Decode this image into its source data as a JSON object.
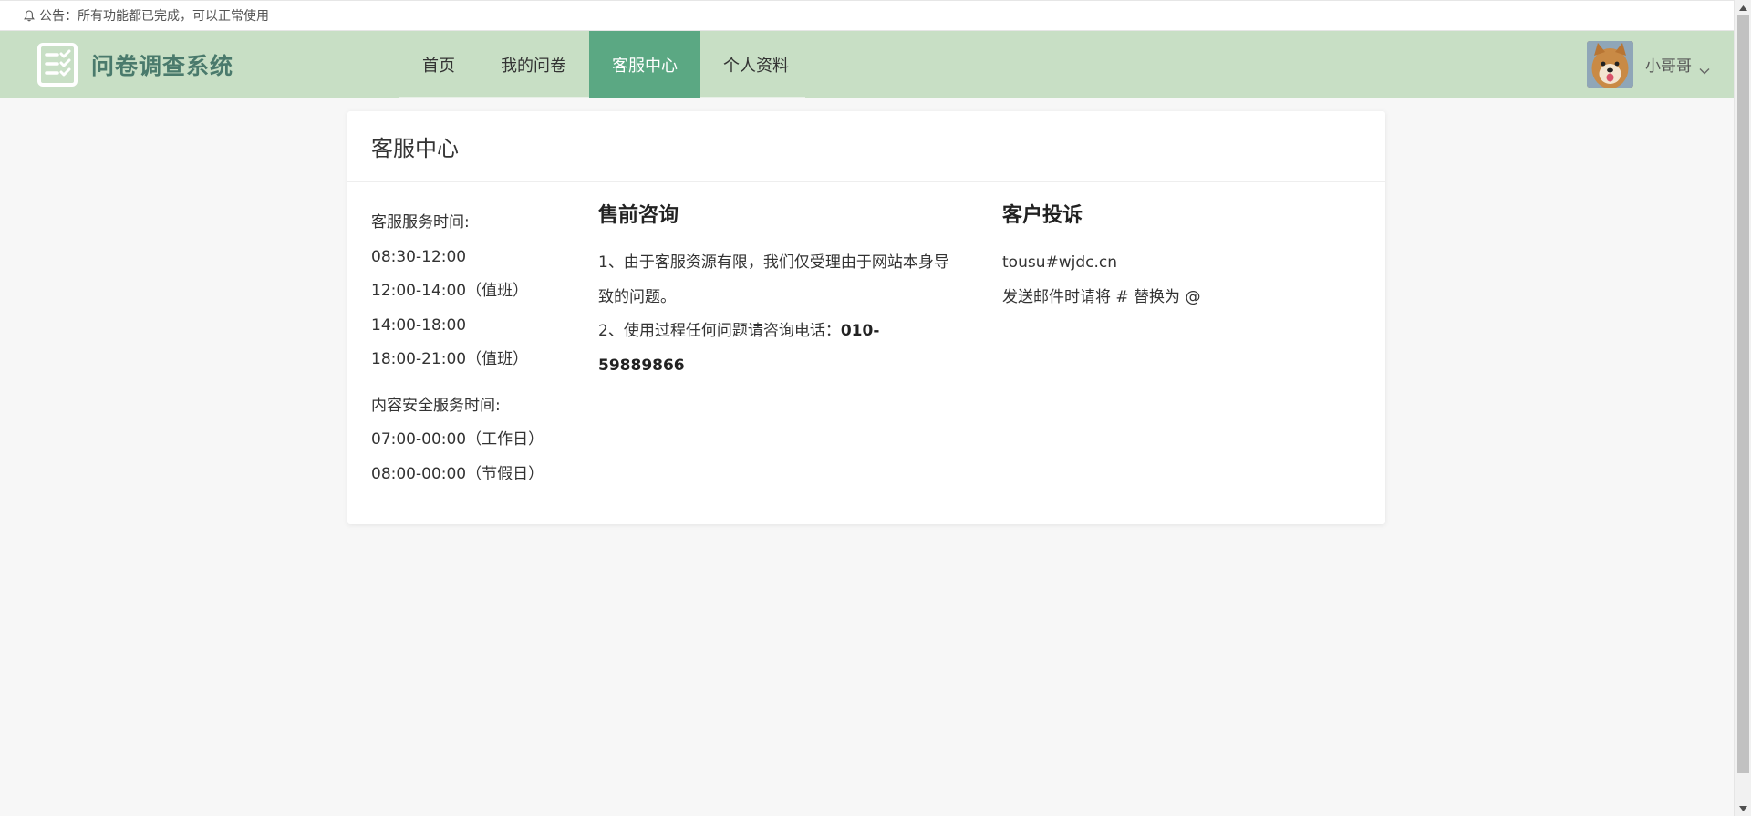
{
  "notice": {
    "label": "公告：所有功能都已完成，可以正常使用"
  },
  "header": {
    "logo_text": "问卷调查系统",
    "nav": [
      {
        "label": "首页",
        "active": false
      },
      {
        "label": "我的问卷",
        "active": false
      },
      {
        "label": "客服中心",
        "active": true
      },
      {
        "label": "个人资料",
        "active": false
      }
    ],
    "user": {
      "name": "小哥哥"
    }
  },
  "card": {
    "title": "客服中心",
    "hours": {
      "service_label": "客服服务时间:",
      "service_times": [
        "08:30-12:00",
        "12:00-14:00（值班）",
        "14:00-18:00",
        "18:00-21:00（值班）"
      ],
      "security_label": "内容安全服务时间:",
      "security_times": [
        "07:00-00:00（工作日）",
        "08:00-00:00（节假日）"
      ]
    },
    "presale": {
      "title": "售前咨询",
      "item1": "1、由于客服资源有限，我们仅受理由于网站本身导致的问题。",
      "item2_prefix": "2、使用过程任何问题请咨询电话：",
      "phone": "010-59889866"
    },
    "complaint": {
      "title": "客户投诉",
      "email": "tousu#wjdc.cn",
      "note": "发送邮件时请将 # 替换为 @"
    }
  },
  "colors": {
    "header_bg": "#c8dfc5",
    "nav_active_bg": "#5ba883",
    "logo_text": "#4a7a6c",
    "page_bg": "#f7f7f7"
  },
  "icons": {
    "notice": "bell-icon",
    "logo": "checklist-icon",
    "user_menu": "chevron-down-icon",
    "scroll_up": "arrow-up-icon",
    "scroll_down": "arrow-down-icon"
  }
}
